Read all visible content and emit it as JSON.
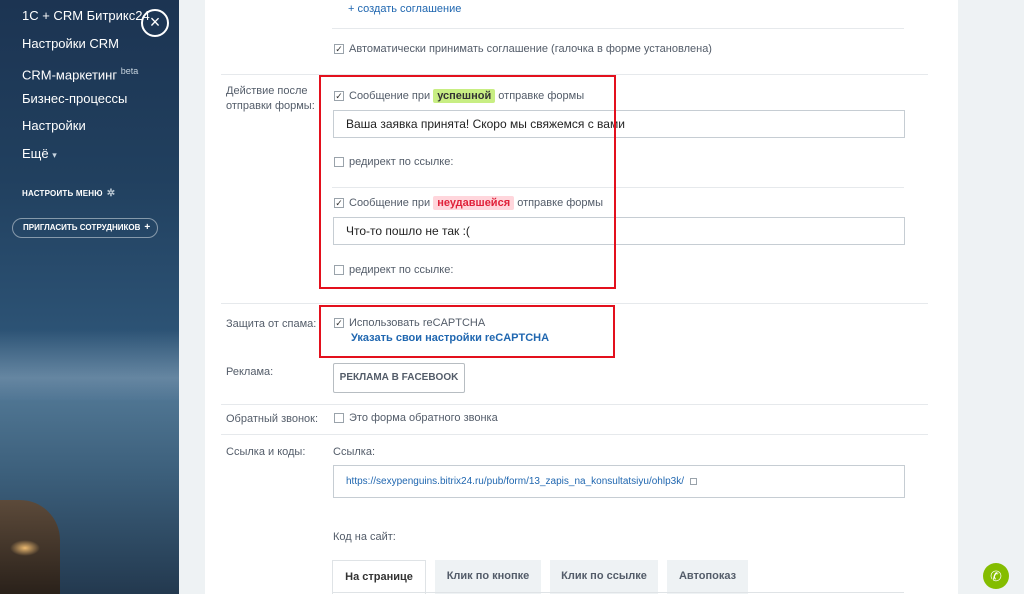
{
  "sidebar": {
    "items": [
      {
        "label": "1С + CRM Битрикс24"
      },
      {
        "label": "Настройки CRM"
      },
      {
        "label": "CRM-маркетинг",
        "badge": "beta"
      },
      {
        "label": "Бизнес-процессы"
      },
      {
        "label": "Настройки"
      },
      {
        "label": "Ещё",
        "caret": "▾"
      }
    ],
    "configure_menu": "НАСТРОИТЬ МЕНЮ",
    "invite": "ПРИГЛАСИТЬ СОТРУДНИКОВ",
    "close_icon": "×"
  },
  "form": {
    "create_agreement": "+ создать соглашение",
    "auto_accept": "Автоматически принимать соглашение (галочка в форме установлена)",
    "after_submit_label": "Действие после отправки формы:",
    "success": {
      "prefix": "Сообщение при",
      "tag": "успешной",
      "suffix": "отправке формы",
      "value": "Ваша заявка принята! Скоро мы свяжемся с вами",
      "redirect": "редирект по ссылке:"
    },
    "failure": {
      "prefix": "Сообщение при",
      "tag": "неудавшейся",
      "suffix": "отправке формы",
      "value": "Что-то пошло не так :(",
      "redirect": "редирект по ссылке:"
    },
    "spam_label": "Защита от спама:",
    "recaptcha": "Использовать reCAPTCHA",
    "recaptcha_link": "Указать свои настройки reCAPTCHA",
    "ads_label": "Реклама:",
    "fb_button": "РЕКЛАМА В FACEBOOK",
    "callback_label": "Обратный звонок:",
    "callback_checkbox": "Это форма обратного звонка",
    "links_label": "Ссылка и коды:",
    "link_caption": "Ссылка:",
    "link_url": "https://sexypenguins.bitrix24.ru/pub/form/13_zapis_na_konsultatsiyu/ohlp3k/",
    "code_caption": "Код на сайт:",
    "tabs": [
      {
        "label": "На странице",
        "active": true
      },
      {
        "label": "Клик по кнопке"
      },
      {
        "label": "Клик по ссылке"
      },
      {
        "label": "Автопоказ"
      }
    ]
  },
  "colors": {
    "highlight_box": "#e3101d",
    "success_tag": "#c8ee83",
    "fail_tag": "#ffd6dc",
    "link": "#2067b0"
  }
}
